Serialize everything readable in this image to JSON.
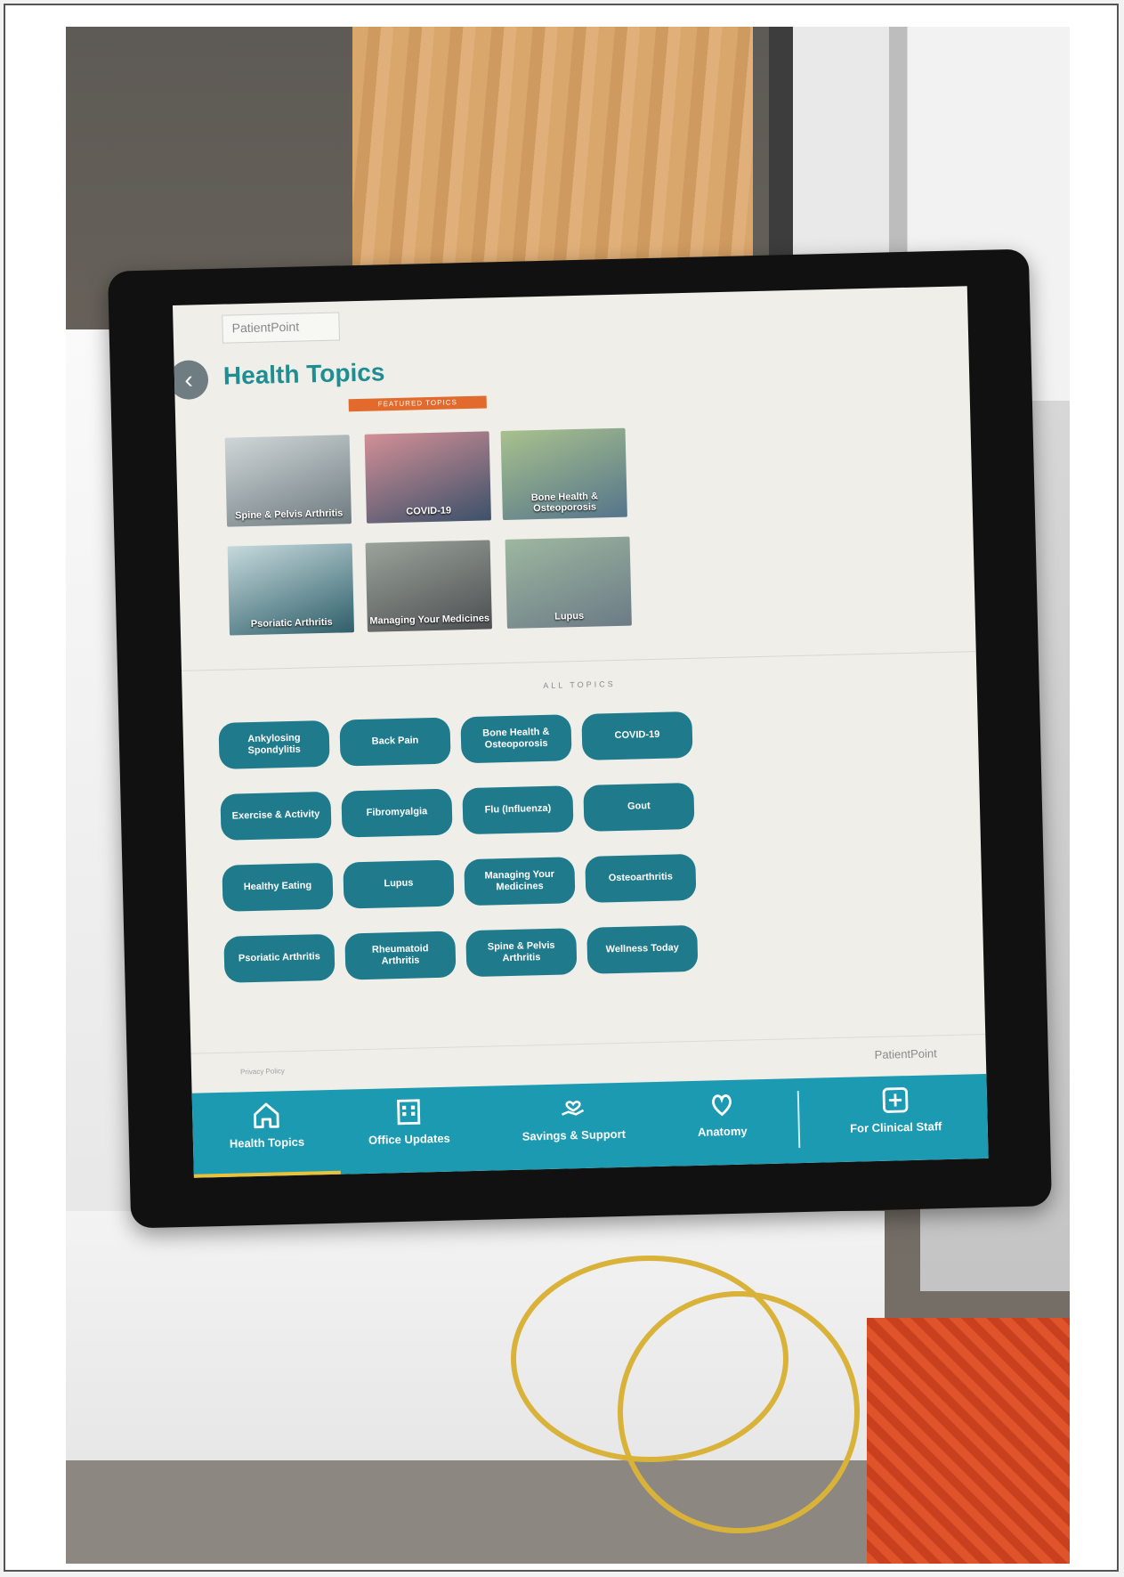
{
  "app": {
    "logo_text": "PatientPoint"
  },
  "header": {
    "title": "Health Topics",
    "featured_label": "FEATURED TOPICS"
  },
  "featured": [
    {
      "label": "Spine & Pelvis Arthritis"
    },
    {
      "label": "COVID-19"
    },
    {
      "label": "Bone Health & Osteoporosis"
    },
    {
      "label": "Psoriatic Arthritis"
    },
    {
      "label": "Managing Your Medicines"
    },
    {
      "label": "Lupus"
    }
  ],
  "all_topics": {
    "label": "ALL TOPICS",
    "items": [
      "Ankylosing Spondylitis",
      "Back Pain",
      "Bone Health & Osteoporosis",
      "COVID-19",
      "Exercise & Activity",
      "Fibromyalgia",
      "Flu (Influenza)",
      "Gout",
      "Healthy Eating",
      "Lupus",
      "Managing Your Medicines",
      "Osteoarthritis",
      "Psoriatic Arthritis",
      "Rheumatoid Arthritis",
      "Spine & Pelvis Arthritis",
      "Wellness Today"
    ]
  },
  "footer": {
    "left_text": "Privacy Policy",
    "right_logo": "PatientPoint"
  },
  "nav": {
    "items": [
      {
        "label": "Health Topics",
        "icon": "home-icon"
      },
      {
        "label": "Office Updates",
        "icon": "building-icon"
      },
      {
        "label": "Savings & Support",
        "icon": "hand-heart-icon"
      },
      {
        "label": "Anatomy",
        "icon": "heart-anatomy-icon"
      },
      {
        "label": "For Clinical Staff",
        "icon": "medical-cross-icon"
      }
    ]
  }
}
